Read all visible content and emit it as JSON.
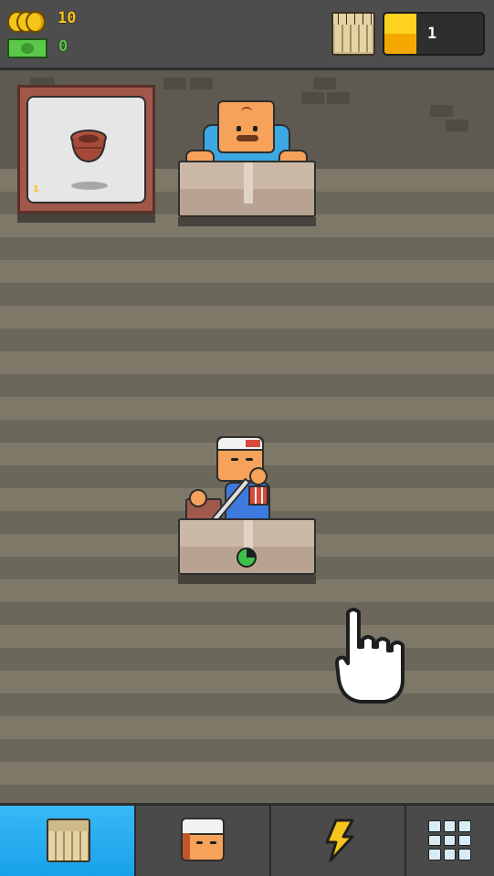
{
  "hud": {
    "coins": "10",
    "cash": "0",
    "store_level": "1",
    "store_progress": 0.32
  },
  "display_case": {
    "item": "clay-pot-icon",
    "count": "1"
  },
  "tabs": [
    {
      "icon": "store-icon",
      "active": true
    },
    {
      "icon": "worker-icon",
      "active": false
    },
    {
      "icon": "lightning-icon",
      "active": false
    },
    {
      "icon": "grid-menu-icon",
      "active": false
    }
  ],
  "colors": {
    "coin": "#f6c51a",
    "cash": "#5cc84a",
    "progress": "#ffd21e",
    "active_tab": "#18a2ea"
  }
}
